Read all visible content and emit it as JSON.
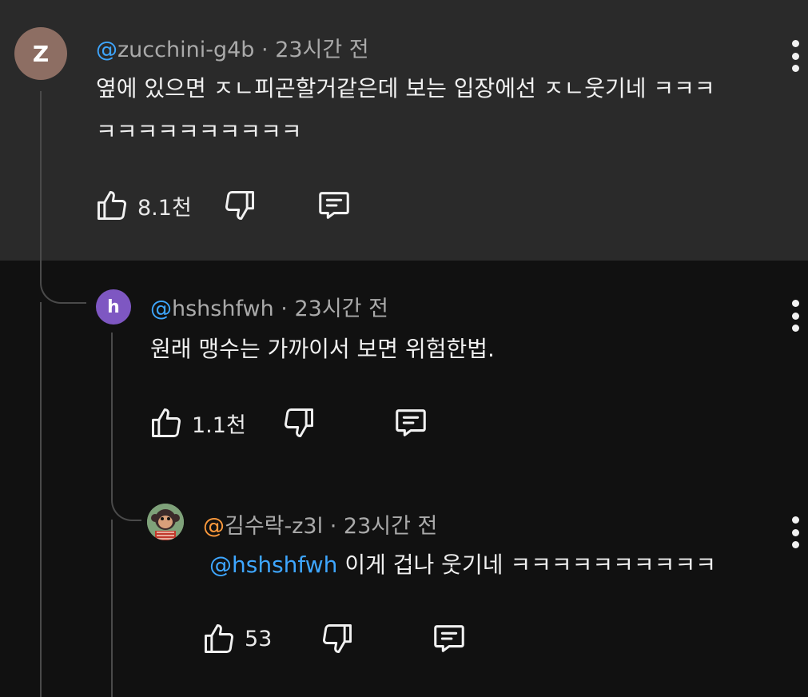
{
  "comments": [
    {
      "avatar_letter": "Z",
      "avatar_color": "#8d6e63",
      "handle": "zucchini-g4b",
      "time": "23시간 전",
      "text_line1": "옆에 있으면 ㅈㄴ피곤할거같은데 보는 입장에선 ㅈㄴ웃기네 ㅋㅋㅋ",
      "text_line2": "ㅋㅋㅋㅋㅋㅋㅋㅋㅋㅋ",
      "likes": "8.1천"
    },
    {
      "avatar_letter": "h",
      "avatar_color": "#7e57c2",
      "handle": "hshshfwh",
      "time": "23시간 전",
      "text": "원래 맹수는 가까이서 보면 위험한법.",
      "likes": "1.1천"
    },
    {
      "avatar_icon": "monkey-avatar-icon",
      "handle": "김수락-z3l",
      "time": "23시간 전",
      "mention": "@hshshfwh",
      "text": "이게 겁나 웃기네 ㅋㅋㅋㅋㅋㅋㅋㅋㅋㅋ",
      "likes": "53"
    }
  ],
  "ui": {
    "at_symbol": "@",
    "separator": "·",
    "highlight_bg": "#2a2a2a",
    "link_color": "#3ea6ff"
  }
}
